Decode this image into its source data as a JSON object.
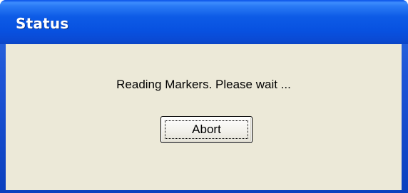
{
  "window": {
    "title": "Status"
  },
  "dialog": {
    "message": "Reading Markers. Please wait ...",
    "abort_label": "Abort"
  },
  "colors": {
    "titlebar_blue": "#0851e0",
    "client_background": "#ece9d8"
  }
}
